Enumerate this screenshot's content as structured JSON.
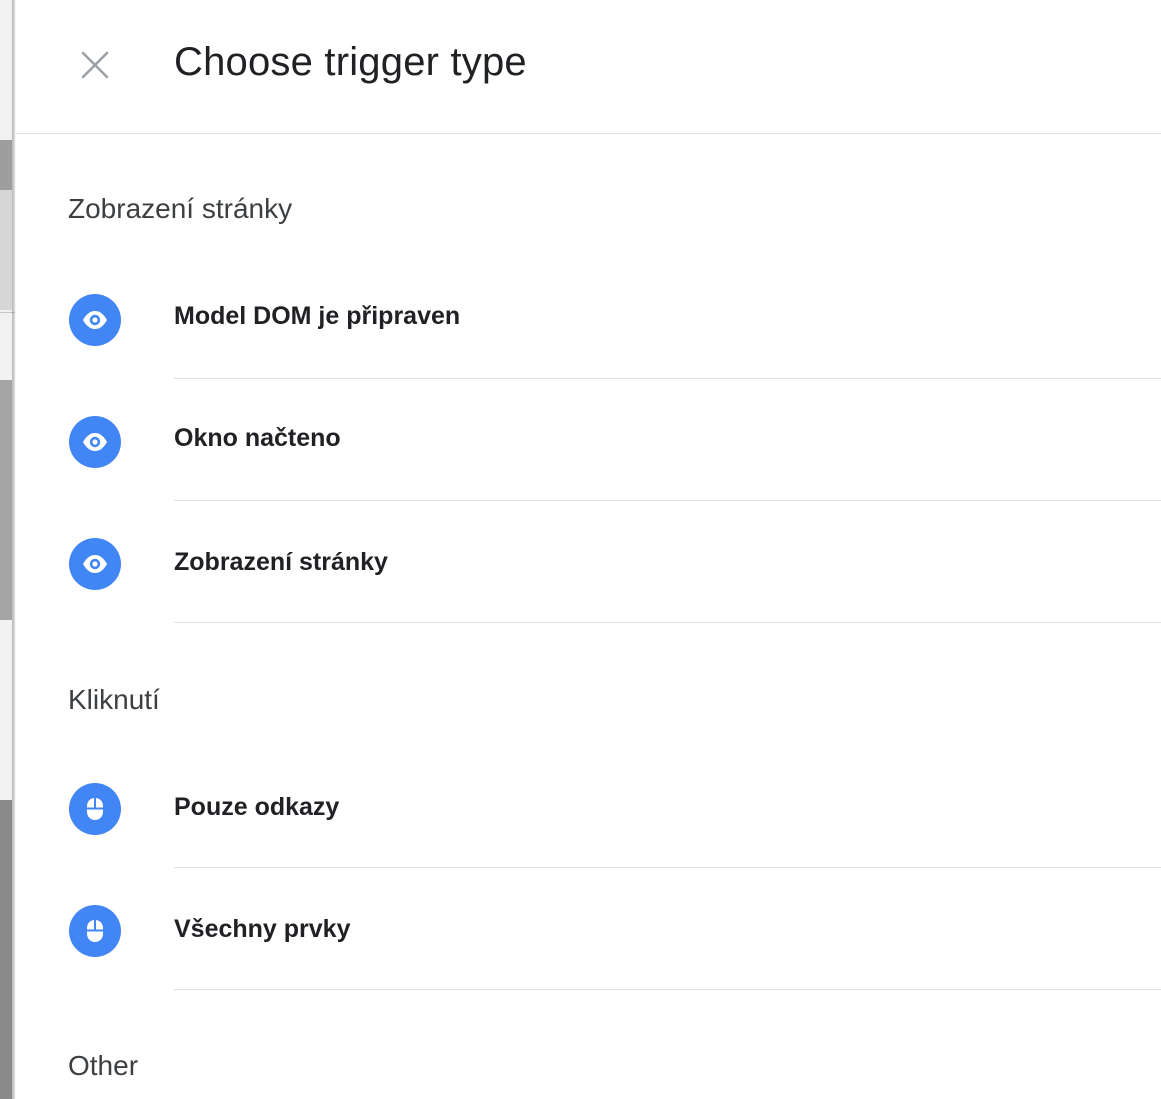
{
  "dialog": {
    "title": "Choose trigger type",
    "close_icon": "close-icon"
  },
  "sections": [
    {
      "title": "Zobrazení stránky",
      "items": [
        {
          "label": "Model DOM je připraven",
          "icon": "eye-icon"
        },
        {
          "label": "Okno načteno",
          "icon": "eye-icon"
        },
        {
          "label": "Zobrazení stránky",
          "icon": "eye-icon"
        }
      ]
    },
    {
      "title": "Kliknutí",
      "items": [
        {
          "label": "Pouze odkazy",
          "icon": "mouse-icon"
        },
        {
          "label": "Všechny prvky",
          "icon": "mouse-icon"
        }
      ]
    },
    {
      "title": "Other",
      "items": []
    }
  ],
  "colors": {
    "accent": "#4285f4",
    "divider": "#e0e0e0",
    "text": "#202124"
  }
}
